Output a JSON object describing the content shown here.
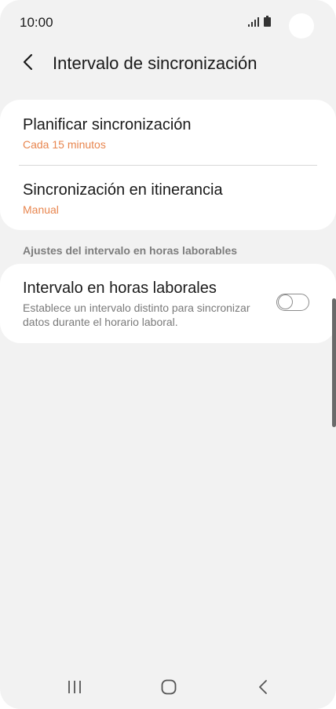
{
  "status_bar": {
    "time": "10:00",
    "icons": [
      "signal-icon",
      "battery-icon"
    ]
  },
  "header": {
    "back_icon": "back-arrow-icon",
    "title": "Intervalo de sincronización"
  },
  "sync_card": {
    "schedule": {
      "title": "Planificar sincronización",
      "value": "Cada 15 minutos"
    },
    "roaming": {
      "title": "Sincronización en itinerancia",
      "value": "Manual"
    }
  },
  "work_hours_section": {
    "header": "Ajustes del intervalo en horas laborables",
    "item": {
      "title": "Intervalo en horas laborales",
      "description": "Establece un intervalo distinto para sincronizar datos durante el horario laboral.",
      "toggle_on": false
    }
  },
  "nav_bar": {
    "icons": [
      "recents-icon",
      "home-icon",
      "back-icon"
    ]
  },
  "colors": {
    "accent": "#e8864f",
    "background": "#f2f2f2",
    "card": "#ffffff",
    "text_primary": "#1a1a1a",
    "text_secondary": "#7a7a7a"
  }
}
